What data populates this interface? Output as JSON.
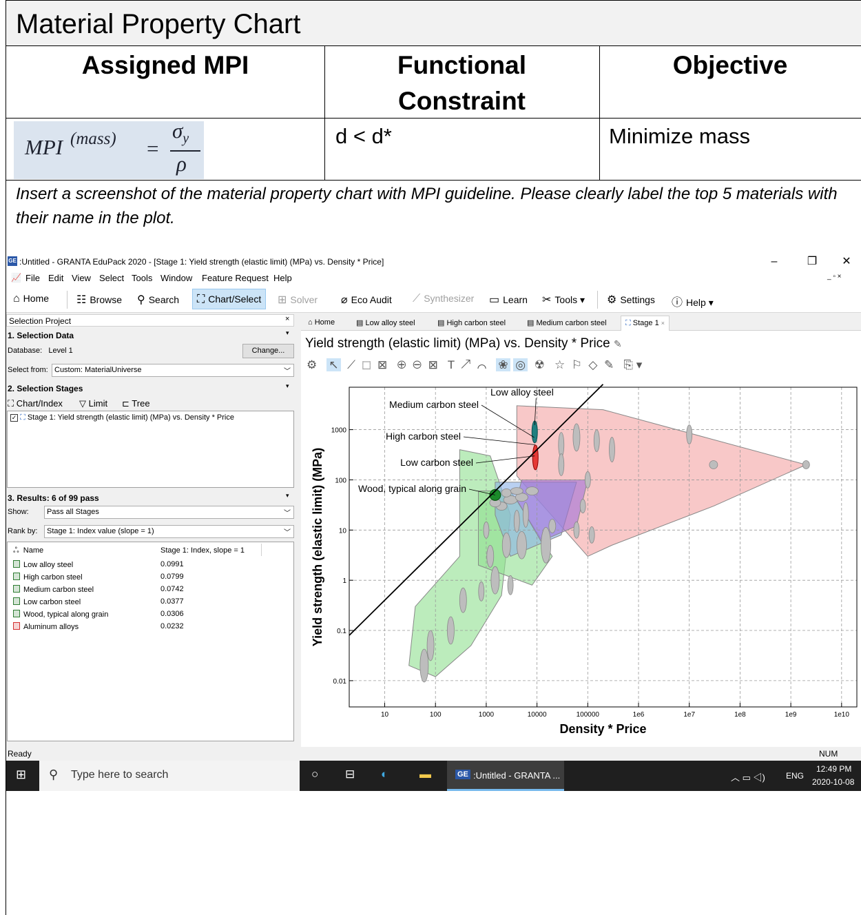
{
  "doc": {
    "title": "Material Property Chart",
    "headers": [
      "Assigned MPI",
      "Functional\nConstraint",
      "Objective"
    ],
    "mpi_formula": {
      "lhs": "MPI",
      "superscript": "(mass)",
      "eq": "=",
      "numerator": "σ",
      "numerator_sub": "y",
      "denominator": "ρ"
    },
    "constraint": "d < d*",
    "objective": "Minimize mass",
    "instruction": "Insert a screenshot of the material property chart with MPI guideline. Please clearly label the top 5 materials with their name in the plot."
  },
  "app": {
    "window_title": ":Untitled - GRANTA EduPack 2020 - [Stage 1: Yield strength (elastic limit) (MPa) vs. Density * Price]",
    "app_icon": "GE",
    "menu": [
      "File",
      "Edit",
      "View",
      "Select",
      "Tools",
      "Window",
      "Feature Request",
      "Help"
    ],
    "toolbar": [
      "Home",
      "Browse",
      "Search",
      "Chart/Select",
      "Solver",
      "Eco Audit",
      "Synthesizer",
      "Learn",
      "Tools ▾",
      "Settings",
      "Help ▾"
    ],
    "left": {
      "panel_title": "Selection Project",
      "sec1": "1. Selection Data",
      "database_label": "Database:",
      "database_value": "Level 1",
      "change_button": "Change...",
      "select_from_label": "Select from:",
      "select_from_value": "Custom: MaterialUniverse",
      "sec2": "2. Selection Stages",
      "stage_tools": [
        "Chart/Index",
        "Limit",
        "Tree"
      ],
      "stage_item": "Stage 1: Yield strength (elastic limit) (MPa) vs. Density * Price",
      "sec3": "3. Results: 6 of 99 pass",
      "show_label": "Show:",
      "show_value": "Pass all Stages",
      "rank_label": "Rank by:",
      "rank_value": "Stage 1: Index value (slope = 1)",
      "col_name": "Name",
      "col_index": "Stage 1: Index, slope = 1",
      "results": [
        {
          "name": "Low alloy steel",
          "value": "0.0991",
          "color": "#2e7d32"
        },
        {
          "name": "High carbon steel",
          "value": "0.0799",
          "color": "#2e7d32"
        },
        {
          "name": "Medium carbon steel",
          "value": "0.0742",
          "color": "#2e7d32"
        },
        {
          "name": "Low carbon steel",
          "value": "0.0377",
          "color": "#2e7d32"
        },
        {
          "name": "Wood, typical along grain",
          "value": "0.0306",
          "color": "#2e7d32"
        },
        {
          "name": "Aluminum alloys",
          "value": "0.0232",
          "color": "#d32f2f"
        }
      ]
    },
    "tabs": [
      "Home",
      "Low alloy steel",
      "High carbon steel",
      "Medium carbon steel",
      "Stage 1"
    ],
    "chart_title": "Yield strength (elastic limit) (MPa) vs. Density * Price",
    "status": "Ready",
    "num_indicator": "NUM",
    "taskbar": {
      "search_placeholder": "Type here to search",
      "active_app": ":Untitled - GRANTA ...",
      "lang": "ENG",
      "time": "12:49 PM",
      "date": "2020-10-08"
    }
  },
  "chart_data": {
    "type": "scatter",
    "title": "",
    "xlabel": "Density * Price",
    "ylabel": "Yield strength (elastic limit) (MPa)",
    "x_scale": "log",
    "y_scale": "log",
    "xlim": [
      2,
      20000000000
    ],
    "ylim": [
      0.003,
      7000
    ],
    "x_ticks": [
      "10",
      "100",
      "1000",
      "10000",
      "100000",
      "1e6",
      "1e7",
      "1e8",
      "1e9",
      "1e10"
    ],
    "y_ticks": [
      "0.01",
      "0.1",
      "1",
      "10",
      "100",
      "1000"
    ],
    "grid": true,
    "guideline": {
      "slope": 1,
      "points": [
        [
          2,
          0.08
        ],
        [
          200000,
          8000
        ]
      ]
    },
    "labeled_points": [
      {
        "name": "Low alloy steel",
        "x": 9000,
        "y": 900
      },
      {
        "name": "Medium carbon steel",
        "x": 8800,
        "y": 700
      },
      {
        "name": "High carbon steel",
        "x": 9200,
        "y": 500
      },
      {
        "name": "Low carbon steel",
        "x": 9000,
        "y": 300
      },
      {
        "name": "Wood, typical along grain",
        "x": 1500,
        "y": 50
      }
    ],
    "regions": [
      {
        "name": "metals",
        "color": "#f4a3a3"
      },
      {
        "name": "natural materials",
        "color": "#8fe08f"
      },
      {
        "name": "polymers",
        "color": "#8ab0e8"
      },
      {
        "name": "composites",
        "color": "#a070d8"
      }
    ]
  }
}
